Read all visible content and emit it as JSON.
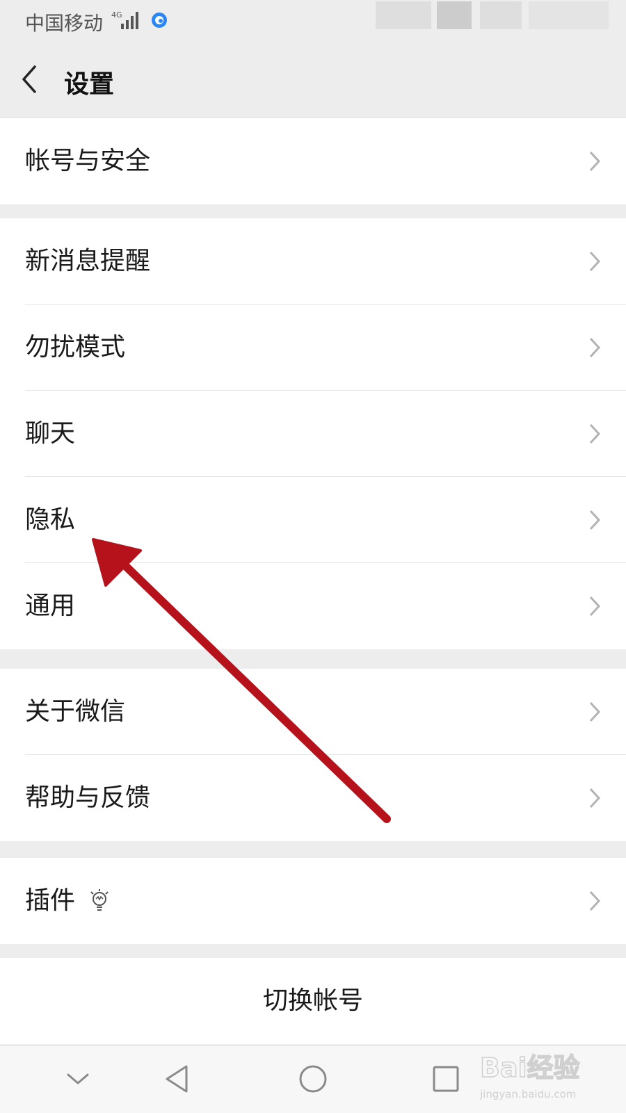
{
  "status_bar": {
    "carrier": "中国移动",
    "network": "4G"
  },
  "header": {
    "title": "设置"
  },
  "groups": [
    {
      "items": [
        {
          "label": "帐号与安全"
        }
      ]
    },
    {
      "items": [
        {
          "label": "新消息提醒"
        },
        {
          "label": "勿扰模式"
        },
        {
          "label": "聊天"
        },
        {
          "label": "隐私"
        },
        {
          "label": "通用"
        }
      ]
    },
    {
      "items": [
        {
          "label": "关于微信"
        },
        {
          "label": "帮助与反馈"
        }
      ]
    },
    {
      "items": [
        {
          "label": "插件",
          "icon": "bulb-icon"
        }
      ]
    }
  ],
  "switch_account": {
    "label": "切换帐号"
  },
  "nav_bar": {
    "icons": [
      "chevron-down-icon",
      "back-triangle-icon",
      "home-circle-icon",
      "recents-square-icon"
    ]
  },
  "watermark": {
    "text": "Bai经验",
    "url": "jingyan.baidu.com"
  },
  "colors": {
    "background": "#ededed",
    "card": "#ffffff",
    "arrow": "#b5121b",
    "text": "#1a1a1a"
  }
}
